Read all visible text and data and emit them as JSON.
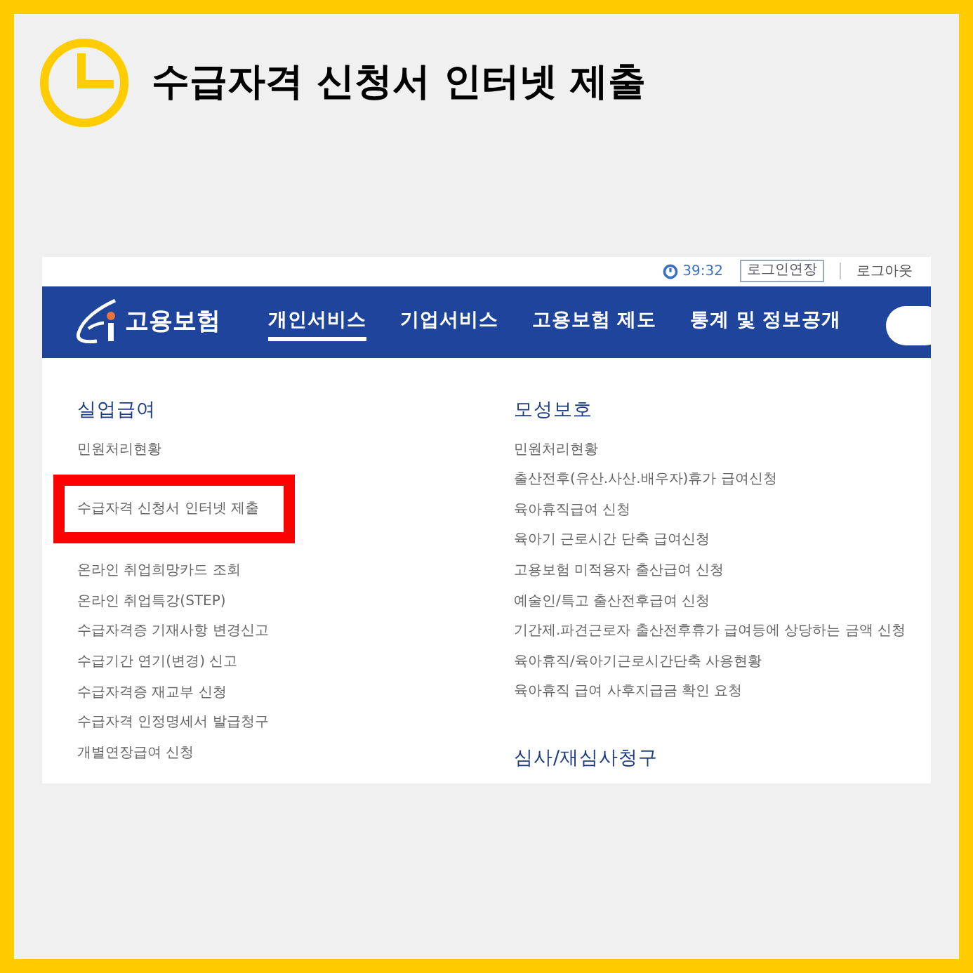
{
  "title": "수급자격 신청서 인터넷 제출",
  "site": {
    "top_bar": {
      "timer": "39:32",
      "extend_button": "로그인연장",
      "logout_link": "로그아웃"
    },
    "nav": {
      "logo": "고용보험",
      "items": [
        {
          "label": "개인서비스",
          "selected": true
        },
        {
          "label": "기업서비스",
          "selected": false
        },
        {
          "label": "고용보험 제도",
          "selected": false
        },
        {
          "label": "통계 및 정보공개",
          "selected": false
        }
      ]
    },
    "columns": [
      {
        "sections": [
          {
            "heading": "실업급여",
            "items": [
              {
                "label": "민원처리현황",
                "highlighted": false
              },
              {
                "label": "수급자격 신청서 인터넷 제출",
                "highlighted": true
              },
              {
                "label": "온라인 취업희망카드 조회",
                "highlighted": false
              },
              {
                "label": "온라인 취업특강(STEP)",
                "highlighted": false
              },
              {
                "label": "수급자격증 기재사항 변경신고",
                "highlighted": false
              },
              {
                "label": "수급기간 연기(변경) 신고",
                "highlighted": false
              },
              {
                "label": "수급자격증 재교부 신청",
                "highlighted": false
              },
              {
                "label": "수급자격 인정명세서 발급청구",
                "highlighted": false
              },
              {
                "label": "개별연장급여 신청",
                "highlighted": false
              }
            ]
          }
        ]
      },
      {
        "sections": [
          {
            "heading": "모성보호",
            "items": [
              {
                "label": "민원처리현황",
                "highlighted": false
              },
              {
                "label": "출산전후(유산.사산.배우자)휴가 급여신청",
                "highlighted": false
              },
              {
                "label": "육아휴직급여 신청",
                "highlighted": false
              },
              {
                "label": "육아기 근로시간 단축 급여신청",
                "highlighted": false
              },
              {
                "label": "고용보험 미적용자 출산급여 신청",
                "highlighted": false
              },
              {
                "label": "예술인/특고 출산전후급여 신청",
                "highlighted": false
              },
              {
                "label": "기간제.파견근로자 출산전후휴가 급여등에 상당하는 금액 신청",
                "highlighted": false
              },
              {
                "label": "육아휴직/육아기근로시간단축 사용현황",
                "highlighted": false
              },
              {
                "label": "육아휴직 급여 사후지급금 확인 요청",
                "highlighted": false
              }
            ]
          },
          {
            "heading": "심사/재심사청구"
          }
        ]
      }
    ]
  }
}
